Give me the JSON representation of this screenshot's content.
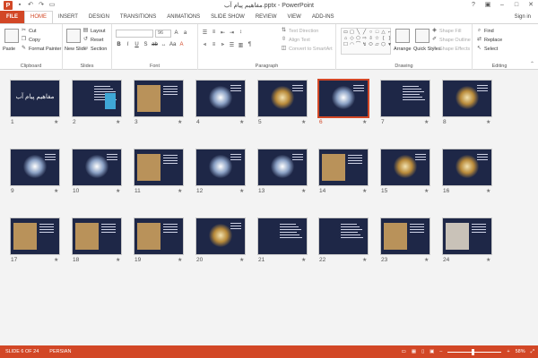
{
  "window": {
    "title": "مفاهیم پیام آب.pptx - PowerPoint",
    "minimize_icon": "minimize-icon",
    "maximize_icon": "maximize-icon",
    "close_icon": "close-icon"
  },
  "tabs": {
    "file": "FILE",
    "home": "HOME",
    "insert": "INSERT",
    "design": "DESIGN",
    "transitions": "TRANSITIONS",
    "animations": "ANIMATIONS",
    "slideshow": "SLIDE SHOW",
    "review": "REVIEW",
    "view": "VIEW",
    "addins": "ADD-INS",
    "signin": "Sign in"
  },
  "ribbon": {
    "clipboard": {
      "label": "Clipboard",
      "paste": "Paste",
      "cut": "Cut",
      "copy": "Copy",
      "format_painter": "Format Painter"
    },
    "slides": {
      "label": "Slides",
      "new_slide": "New Slide",
      "layout": "Layout",
      "reset": "Reset",
      "section": "Section"
    },
    "font": {
      "label": "Font",
      "font_size": "96"
    },
    "paragraph": {
      "label": "Paragraph",
      "text_direction": "Text Direction",
      "align_text": "Align Text",
      "convert_smartart": "Convert to SmartArt"
    },
    "drawing": {
      "label": "Drawing",
      "arrange": "Arrange",
      "quick_styles": "Quick Styles",
      "shape_fill": "Shape Fill",
      "shape_outline": "Shape Outline",
      "shape_effects": "Shape Effects"
    },
    "editing": {
      "label": "Editing",
      "find": "Find",
      "replace": "Replace",
      "select": "Select"
    }
  },
  "slide_title_text": "مفاهیم پیام آب",
  "slide_badge_text": "170",
  "slides": [
    "1",
    "2",
    "3",
    "4",
    "5",
    "6",
    "7",
    "8",
    "9",
    "10",
    "11",
    "12",
    "13",
    "14",
    "15",
    "16",
    "17",
    "18",
    "19",
    "20",
    "21",
    "22",
    "23",
    "24"
  ],
  "selected_slide": "6",
  "status": {
    "slide_info": "SLIDE 6 OF 24",
    "language": "PERSIAN",
    "zoom": "58%"
  },
  "colors": {
    "accent": "#d24726",
    "slide_bg": "#1e2747"
  }
}
